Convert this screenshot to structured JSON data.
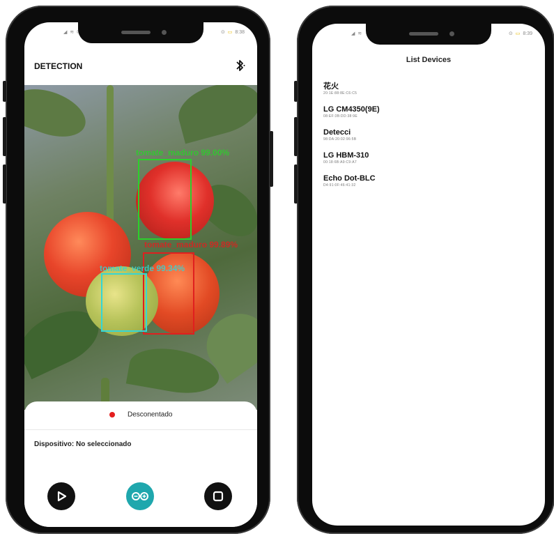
{
  "left_phone": {
    "status_bar": {
      "left": "◢ ≋ ✉",
      "right_icons": "⊙",
      "battery": "▭",
      "time": "8:38"
    },
    "header": {
      "title": "DETECTION",
      "bluetooth_icon": "bluetooth-icon"
    },
    "detections": [
      {
        "label": "tomate_maduro 99.00%",
        "color": "#2bd12b"
      },
      {
        "label": "tomate_maduro 99.89%",
        "color": "#e01f1f"
      },
      {
        "label": "tomate_verde 99.34%",
        "color": "#33d6d6"
      }
    ],
    "connection": {
      "status": "Desconentado",
      "status_color": "#e41e1e"
    },
    "device": {
      "text": "Dispositivo: No seleccionado"
    },
    "controls": {
      "play_icon": "play-icon",
      "arduino_icon": "arduino-infinity-icon",
      "stop_icon": "stop-icon",
      "arduino_color": "#1fa7ad"
    }
  },
  "right_phone": {
    "status_bar": {
      "left": "◢ ≋",
      "right_icons": "⊙",
      "battery": "▭",
      "time": "8:39"
    },
    "title": "List Devices",
    "devices": [
      {
        "name": "花火",
        "mac": "20:1E:88:8E:C6:C5"
      },
      {
        "name": "LG CM4350(9E)",
        "mac": "08:EF:3B:DD:38:9E"
      },
      {
        "name": "Detecci",
        "mac": "98:DA:20:02:96:5B"
      },
      {
        "name": "LG HBM-310",
        "mac": "00:18:6B:A9:C9:A7"
      },
      {
        "name": "Echo Dot-BLC",
        "mac": "D4:91:0F:46:41:32"
      }
    ]
  }
}
